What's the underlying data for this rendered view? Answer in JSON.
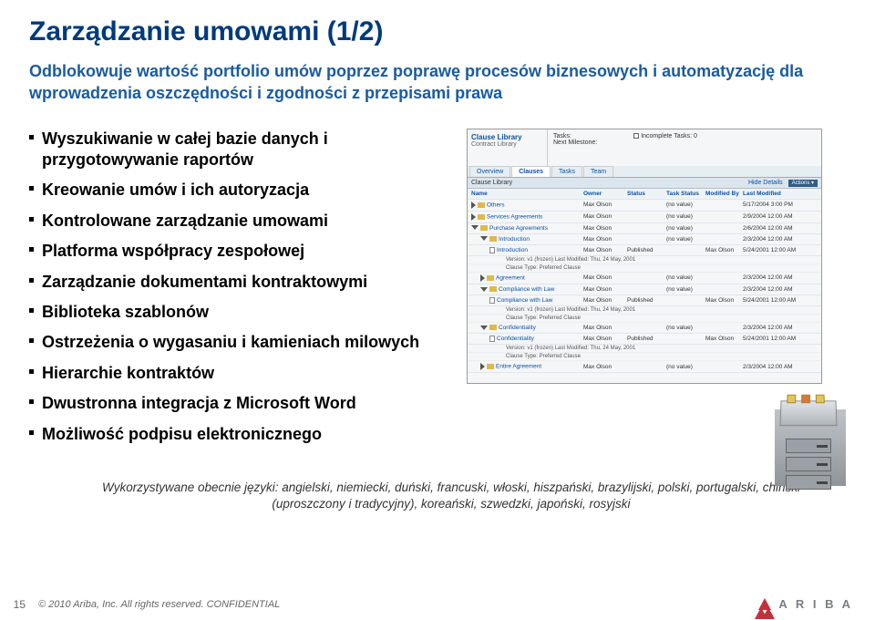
{
  "title": "Zarządzanie umowami (1/2)",
  "subtitle": "Odblokowuje wartość portfolio umów poprzez poprawę procesów biznesowych i automatyzację dla wprowadzenia oszczędności i zgodności z przepisami prawa",
  "bullets": [
    "Wyszukiwanie w całej bazie danych i przygotowywanie raportów",
    "Kreowanie umów i ich autoryzacja",
    "Kontrolowane zarządzanie umowami",
    "Platforma współpracy zespołowej",
    "Zarządzanie dokumentami kontraktowymi",
    "Biblioteka szablonów",
    "Ostrzeżenia o wygasaniu i kamieniach milowych",
    "Hierarchie kontraktów",
    "Dwustronna integracja z Microsoft Word",
    "Możliwość podpisu elektronicznego"
  ],
  "screenshot": {
    "libTitle": "Clause Library",
    "libSub": "Contract Library",
    "tasksLabel": "Tasks:",
    "incompleteLabel": "Incomplete Tasks: 0",
    "milestoneLabel": "Next Milestone:",
    "tabs": [
      "Overview",
      "Clauses",
      "Tasks",
      "Team"
    ],
    "activeTab": 1,
    "barLabel": "Clause Library",
    "hideDetails": "Hide Details",
    "actions": "Actions ▾",
    "headers": {
      "name": "Name",
      "owner": "Owner",
      "status": "Status",
      "task": "Task Status",
      "modby": "Modified By",
      "moddate": "Last Modified"
    },
    "rows": [
      {
        "indent": 0,
        "tri": "r",
        "icon": "folder",
        "name": "Others",
        "owner": "Max Olson",
        "status": "",
        "task": "(no value)",
        "modby": "",
        "moddate": "5/17/2004 3:00 PM"
      },
      {
        "indent": 0,
        "tri": "r",
        "icon": "folder",
        "name": "Services Agreements",
        "owner": "Max Olson",
        "status": "",
        "task": "(no value)",
        "modby": "",
        "moddate": "2/9/2004 12:00 AM"
      },
      {
        "indent": 0,
        "tri": "d",
        "icon": "folder",
        "name": "Purchase Agreements",
        "owner": "Max Olson",
        "status": "",
        "task": "(no value)",
        "modby": "",
        "moddate": "2/6/2004 12:00 AM"
      },
      {
        "indent": 1,
        "tri": "d",
        "icon": "folder",
        "name": "Introduction",
        "owner": "Max Olson",
        "status": "",
        "task": "(no value)",
        "modby": "",
        "moddate": "2/3/2004 12:00 AM"
      },
      {
        "indent": 2,
        "tri": "",
        "icon": "doc",
        "name": "Introduction",
        "owner": "Max Olson",
        "status": "Published",
        "task": "",
        "modby": "Max Olson",
        "moddate": "5/24/2001 12:00 AM",
        "sub": [
          "Version: v1 (frozen)    Last Modified: Thu, 24 May, 2001",
          "Clause Type: Preferred Clause"
        ]
      },
      {
        "indent": 1,
        "tri": "r",
        "icon": "folder",
        "name": "Agreement",
        "owner": "Max Olson",
        "status": "",
        "task": "(no value)",
        "modby": "",
        "moddate": "2/3/2004 12:00 AM"
      },
      {
        "indent": 1,
        "tri": "d",
        "icon": "folder",
        "name": "Compliance with Law",
        "owner": "Max Olson",
        "status": "",
        "task": "(no value)",
        "modby": "",
        "moddate": "2/3/2004 12:00 AM"
      },
      {
        "indent": 2,
        "tri": "",
        "icon": "doc",
        "name": "Compliance with Law",
        "owner": "Max Olson",
        "status": "Published",
        "task": "",
        "modby": "Max Olson",
        "moddate": "5/24/2001 12:00 AM",
        "sub": [
          "Version: v1 (frozen)    Last Modified: Thu, 24 May, 2001",
          "Clause Type: Preferred Clause"
        ]
      },
      {
        "indent": 1,
        "tri": "d",
        "icon": "folder",
        "name": "Confidentiality",
        "owner": "Max Olson",
        "status": "",
        "task": "(no value)",
        "modby": "",
        "moddate": "2/3/2004 12:00 AM"
      },
      {
        "indent": 2,
        "tri": "",
        "icon": "doc",
        "name": "Confidentiality",
        "owner": "Max Olson",
        "status": "Published",
        "task": "",
        "modby": "Max Olson",
        "moddate": "5/24/2001 12:00 AM",
        "sub": [
          "Version: v1 (frozen)    Last Modified: Thu, 24 May, 2001",
          "Clause Type: Preferred Clause"
        ]
      },
      {
        "indent": 1,
        "tri": "r",
        "icon": "folder",
        "name": "Entire Agreement",
        "owner": "Max Olson",
        "status": "",
        "task": "(no value)",
        "modby": "",
        "moddate": "2/3/2004 12:00 AM"
      }
    ]
  },
  "langs": "Wykorzystywane obecnie języki: angielski, niemiecki, duński, francuski, włoski, hiszpański, brazylijski, polski, portugalski, chiński (uproszczony i tradycyjny), koreański, szwedzki, japoński, rosyjski",
  "pageNum": "15",
  "copyright": "© 2010 Ariba, Inc. All rights reserved.  CONFIDENTIAL",
  "logoText": "A R I B A"
}
